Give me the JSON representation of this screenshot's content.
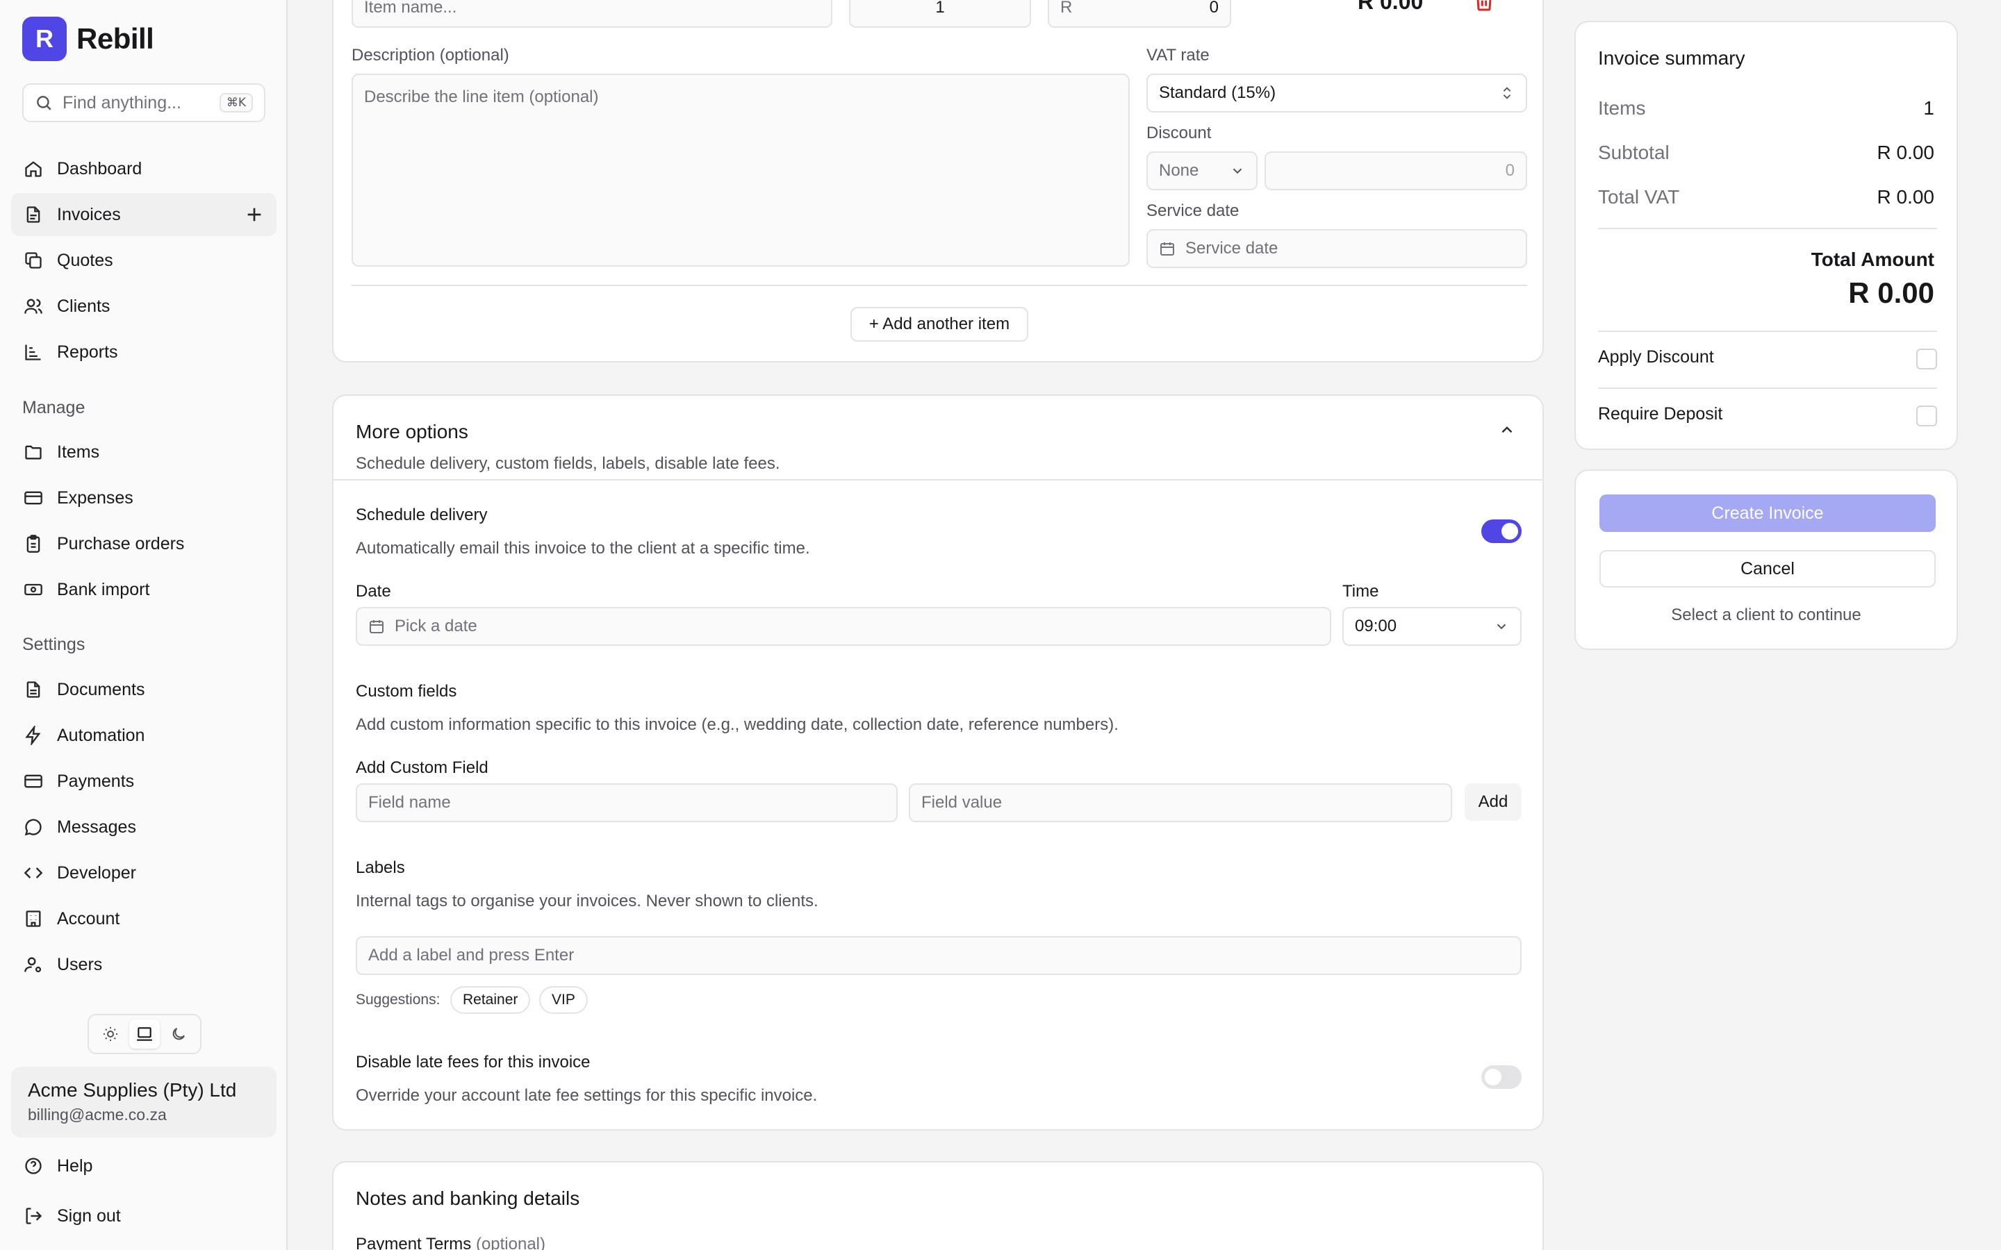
{
  "brand": {
    "logo_letter": "R",
    "name": "Rebill",
    "accent": "#4f46e5"
  },
  "search": {
    "placeholder": "Find anything...",
    "shortcut": "⌘K"
  },
  "nav": {
    "primary": [
      "Dashboard",
      "Invoices",
      "Quotes",
      "Clients",
      "Reports"
    ],
    "manage_label": "Manage",
    "manage": [
      "Items",
      "Expenses",
      "Purchase orders",
      "Bank import"
    ],
    "settings_label": "Settings",
    "settings": [
      "Documents",
      "Automation",
      "Payments",
      "Messages",
      "Developer",
      "Account",
      "Users"
    ],
    "footer": [
      "Help",
      "Sign out"
    ]
  },
  "account": {
    "name": "Acme Supplies (Pty) Ltd",
    "email": "billing@acme.co.za"
  },
  "line_item": {
    "name_placeholder": "Item name...",
    "quantity": "1",
    "currency_prefix": "R",
    "price": "0",
    "line_total": "R 0.00",
    "description_label": "Description (optional)",
    "description_placeholder": "Describe the line item (optional)",
    "vat_label": "VAT rate",
    "vat_value": "Standard (15%)",
    "discount_label": "Discount",
    "discount_type": "None",
    "discount_value": "0",
    "service_date_label": "Service date",
    "service_date_placeholder": "Service date",
    "add_item": "+ Add another item"
  },
  "more_options": {
    "title": "More options",
    "subtitle": "Schedule delivery, custom fields, labels, disable late fees.",
    "schedule_title": "Schedule delivery",
    "schedule_help": "Automatically email this invoice to the client at a specific time.",
    "schedule_enabled": true,
    "date_label": "Date",
    "date_placeholder": "Pick a date",
    "time_label": "Time",
    "time_value": "09:00",
    "custom_title": "Custom fields",
    "custom_help": "Add custom information specific to this invoice (e.g., wedding date, collection date, reference numbers).",
    "add_custom_label": "Add Custom Field",
    "field_name_placeholder": "Field name",
    "field_value_placeholder": "Field value",
    "add_button": "Add",
    "labels_title": "Labels",
    "labels_help": "Internal tags to organise your invoices. Never shown to clients.",
    "label_placeholder": "Add a label and press Enter",
    "suggestions_label": "Suggestions:",
    "suggestions": [
      "Retainer",
      "VIP"
    ],
    "late_fee_title": "Disable late fees for this invoice",
    "late_fee_help": "Override your account late fee settings for this specific invoice.",
    "late_fee_enabled": false
  },
  "notes": {
    "title": "Notes and banking details",
    "payment_terms": "Payment Terms",
    "optional": "(optional)"
  },
  "summary": {
    "title": "Invoice summary",
    "items_label": "Items",
    "items_value": "1",
    "subtotal_label": "Subtotal",
    "subtotal_value": "R 0.00",
    "vat_label": "Total VAT",
    "vat_value": "R 0.00",
    "total_label": "Total Amount",
    "total_value": "R 0.00",
    "apply_discount": "Apply Discount",
    "require_deposit": "Require Deposit"
  },
  "actions": {
    "create": "Create Invoice",
    "cancel": "Cancel",
    "hint": "Select a client to continue",
    "create_color": "#a5a8f2"
  }
}
